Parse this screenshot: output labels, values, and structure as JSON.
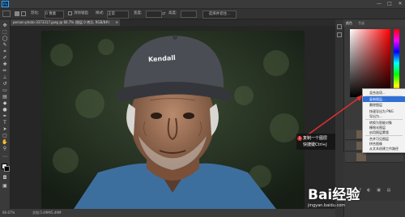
{
  "app": {
    "logo": "Ps",
    "window_controls": [
      "—",
      "□",
      "✕"
    ]
  },
  "options": {
    "feather_label": "羽化:",
    "feather_value": "0 像素",
    "antialias_label": "消除锯齿",
    "style_label": "样式:",
    "style_value": "正常",
    "width_label": "宽度:",
    "height_label": "高度:",
    "select_mask_label": "选择并遮住..."
  },
  "document": {
    "tab_title": "person-photo-3373317.jpeg @ 66.7% (图层 0 拷贝, RGB/8#)",
    "close": "✕"
  },
  "status": {
    "zoom": "66.67%",
    "doc_size": "文档:5.49M/5.49M"
  },
  "panels": {
    "color_tab": "颜色",
    "swatches_tab": "色板"
  },
  "context_menu": {
    "items": [
      "混合选项...",
      "复制图层...",
      "删除图层",
      "快速导出为 PNG",
      "导出为...",
      "转换为智能对象",
      "栅格化图层",
      "启用图层蒙版",
      "合并可见图层",
      "拼合图像",
      "从文本创建工作路径",
      "无颜色"
    ],
    "highlighted_index": 1
  },
  "callout": {
    "number": "1",
    "line1": "复制一个图层",
    "line2": "快捷键Ctrl+J"
  },
  "photo": {
    "cap_text": "Kendall"
  },
  "watermark": {
    "brand": "Bai经验",
    "url": "jingyan.baidu.com"
  },
  "colors": {
    "accent": "#2f6fd6",
    "ps_blue": "#31a8ff",
    "marker_red": "#e03030"
  }
}
